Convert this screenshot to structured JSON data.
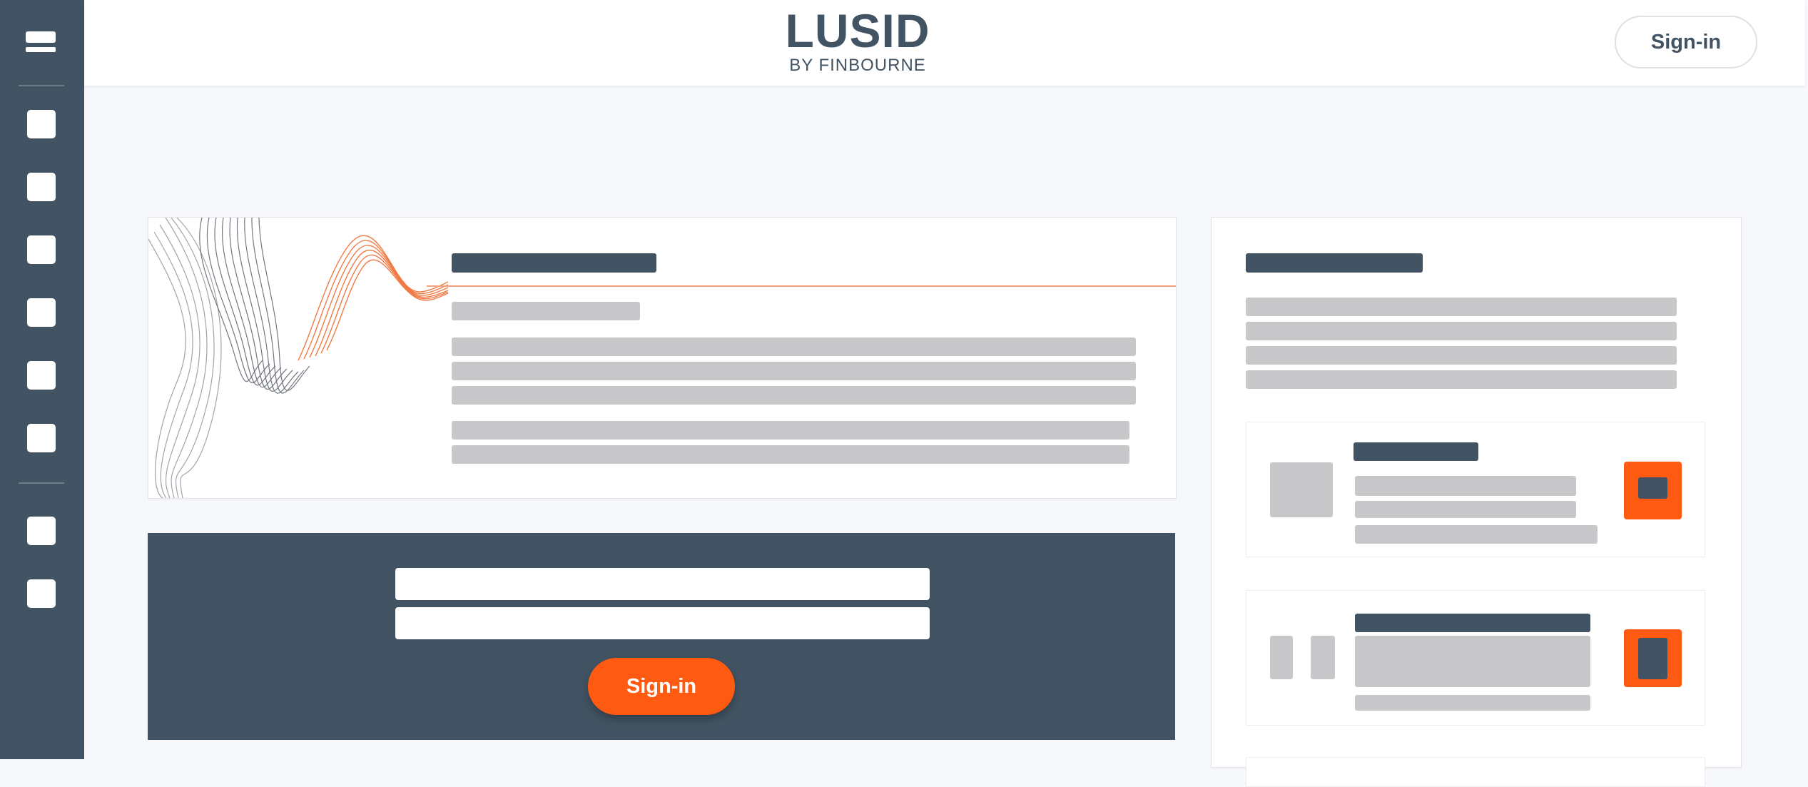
{
  "header": {
    "logo_main": "LUSID",
    "logo_sub": "BY FINBOURNE",
    "signin_label": "Sign-in"
  },
  "signin_panel": {
    "username_placeholder": "",
    "password_placeholder": "",
    "signin_label": "Sign-in"
  },
  "sidebar": {
    "icons": [
      "menu-icon",
      "nav-icon-1",
      "nav-icon-2",
      "nav-icon-3",
      "nav-icon-4",
      "nav-icon-5",
      "nav-icon-6",
      "nav-icon-7",
      "nav-icon-8"
    ]
  },
  "colors": {
    "brand_dark": "#425363",
    "accent_orange": "#fe5a12",
    "placeholder_grey": "#c8c8cb",
    "background": "#f7f8fb"
  }
}
